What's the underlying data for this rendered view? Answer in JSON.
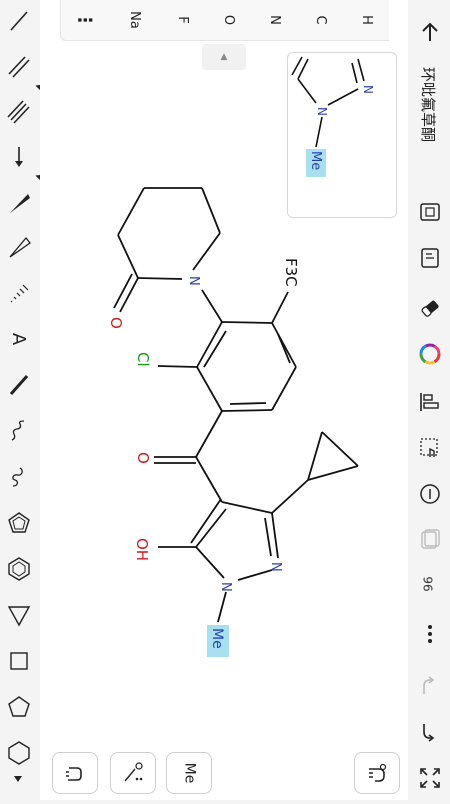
{
  "app": {
    "title": "环吡氟草酮"
  },
  "element_bar": {
    "more_label": "⋮",
    "elements": [
      "Na",
      "F",
      "O",
      "N",
      "C",
      "H"
    ]
  },
  "right_toolbar": {
    "zoom_level": "96"
  },
  "bottom_bar": {
    "me_label": "Me"
  },
  "molecule": {
    "atoms": {
      "f3c": "F3C",
      "cl": "Cl",
      "carbonyl_o": "O",
      "lactam_o": "O",
      "n_ring": "N",
      "oh": "OH",
      "pyrazole_n1": "N",
      "pyrazole_n2": "N",
      "me": "Me"
    },
    "colors": {
      "nitrogen": "#2a3fb0",
      "oxygen": "#cc1a1a",
      "chlorine": "#1a9a1a",
      "highlight": "#a8e0f0",
      "bond": "#111111"
    }
  },
  "preview": {
    "n1": "N",
    "n2": "N",
    "me": "Me"
  }
}
